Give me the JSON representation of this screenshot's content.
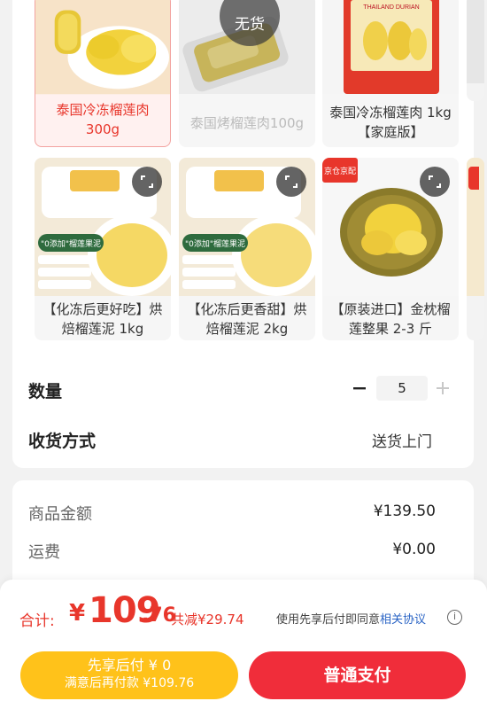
{
  "products": [
    {
      "title": "泰国冷冻榴莲肉300g",
      "line1": "泰国冷冻榴莲肉",
      "line2": "300g",
      "state": "selected",
      "image": "durian-meat-plate"
    },
    {
      "title": "泰国烤榴莲肉100g",
      "line1": "泰国烤榴莲肉100g",
      "line2": "",
      "state": "out-of-stock",
      "out_label": "无货",
      "image": "roasted-durian-tin"
    },
    {
      "title": "泰国冷冻榴莲肉1kg【家庭版】",
      "line1": "泰国冷冻榴莲肉 1kg",
      "line2": "【家庭版】",
      "state": "normal",
      "image": "durian-bag",
      "pack_text": "THAILAND DURIAN"
    },
    {
      "title": "【化冻后更好吃】烘焙榴莲泥 1kg",
      "line1": "【化冻后更好吃】烘",
      "line2": "焙榴莲泥 1kg",
      "state": "normal",
      "image": "durian-puree-box",
      "box_label": "\"0添加\"榴莲果泥"
    },
    {
      "title": "【化冻后更香甜】烘焙榴莲泥 2kg",
      "line1": "【化冻后更香甜】烘",
      "line2": "焙榴莲泥 2kg",
      "state": "normal",
      "image": "durian-puree-box",
      "box_label": "\"0添加\"榴莲果泥"
    },
    {
      "title": "【原装进口】金枕榴莲整果 2-3 斤",
      "line1": "【原装进口】金枕榴",
      "line2": "莲整果 2-3 斤",
      "state": "normal",
      "image": "whole-durian",
      "badge": "京仓京配"
    }
  ],
  "quantity": {
    "label": "数量",
    "value": "5",
    "minus": "−",
    "plus": "+"
  },
  "delivery": {
    "label": "收货方式",
    "value": "送货上门"
  },
  "fees": {
    "goods_label": "商品金额",
    "goods_value": "¥139.50",
    "shipping_label": "运费",
    "shipping_value": "¥0.00"
  },
  "footer": {
    "total_label": "合计:",
    "total_yen": "¥",
    "total_int": "109",
    "total_dec": ".76",
    "save_text": "共减¥29.74",
    "agree_text": "使用先享后付即同意",
    "agree_link": "相关协议",
    "info": "i",
    "later_line1": "先享后付 ¥ 0",
    "later_line2": "满意后再付款 ¥109.76",
    "pay_label": "普通支付"
  },
  "colors": {
    "accent": "#e8362b",
    "pay": "#f02d3a",
    "later": "#ffc21a",
    "link": "#2a64c5"
  }
}
